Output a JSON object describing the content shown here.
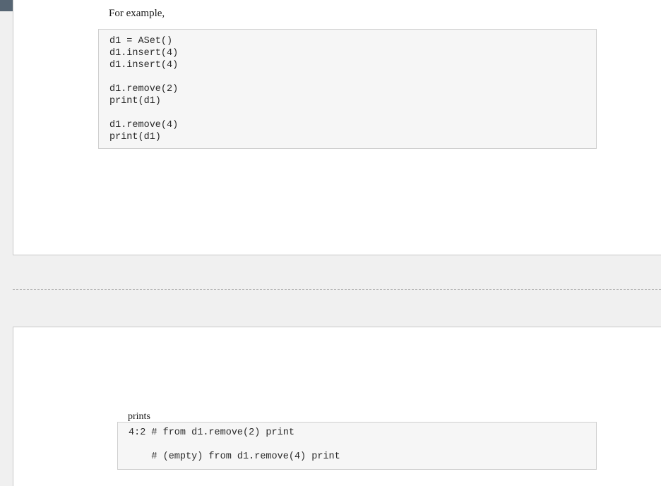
{
  "section_1": {
    "intro_text": "For example,",
    "code_lines": [
      "d1 = ASet()",
      "d1.insert(4)",
      "d1.insert(4)",
      "",
      "d1.remove(2)",
      "print(d1)",
      "",
      "d1.remove(4)",
      "print(d1)"
    ]
  },
  "section_2": {
    "prints_text": "prints",
    "output_lines": [
      "4:2 # from d1.remove(2) print",
      "",
      "    # (empty) from d1.remove(4) print"
    ]
  }
}
